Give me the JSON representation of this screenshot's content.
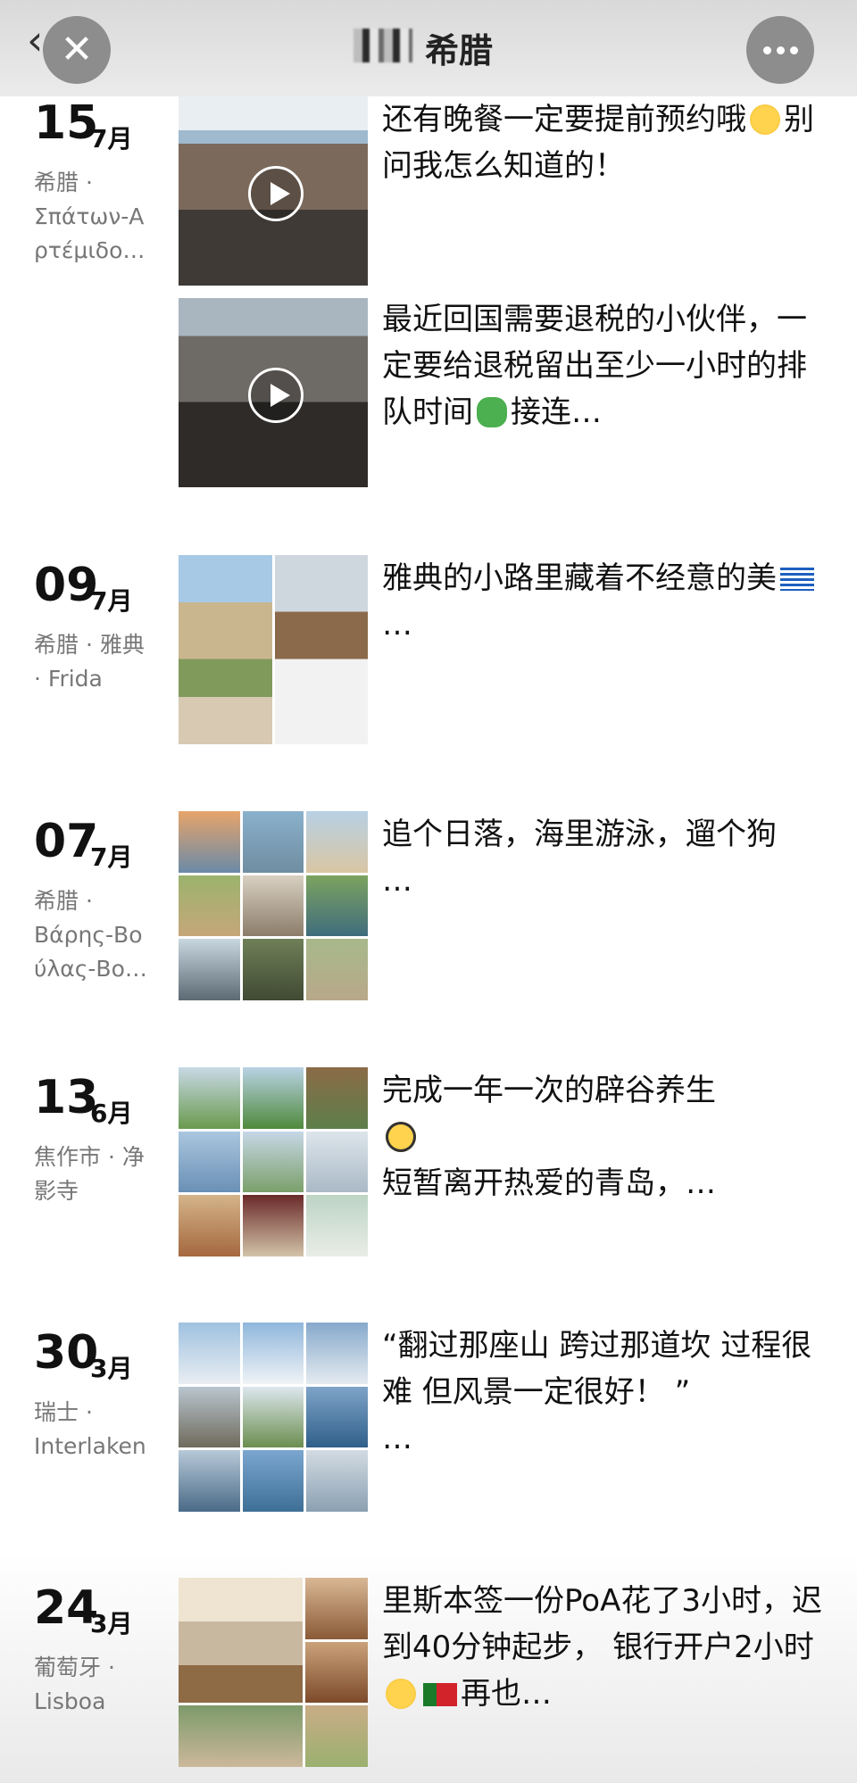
{
  "header": {
    "title": "希腊",
    "back_icon": "‹",
    "close_icon": "✕"
  },
  "entries": [
    {
      "day": "15",
      "month": "7月",
      "place": "希腊 ·\nΣπάτων-Α\nρτέμιδο…",
      "captions": [
        {
          "text_a": "还有晚餐一定要提前预约哦",
          "text_b": "别问我怎么知道的！"
        },
        {
          "text_a": "最近回国需要退税的小伙伴，一定要给退税留出至少一小时的排队时间",
          "text_b": "接连…"
        }
      ]
    },
    {
      "day": "09",
      "month": "7月",
      "place": "希腊 · 雅典\n· Frida",
      "caption": "雅典的小路里藏着不经意的美",
      "more": "…"
    },
    {
      "day": "07",
      "month": "7月",
      "place": "希腊 ·\nΒάρης-Βο\nύλας-Βο…",
      "caption": "追个日落，海里游泳，遛个狗",
      "more": "…"
    },
    {
      "day": "13",
      "month": "6月",
      "place": "焦作市 · 净\n影寺",
      "caption": "完成一年一次的辟谷养生",
      "caption2": "短暂离开热爱的青岛，…"
    },
    {
      "day": "30",
      "month": "3月",
      "place": "瑞士 ·\nInterlaken",
      "caption": "“翻过那座山 跨过那道坎 过程很难 但风景一定很好！ ”",
      "more": "…"
    },
    {
      "day": "24",
      "month": "3月",
      "place": "葡萄牙 ·\nLisboa",
      "caption_a": "里斯本签一份PoA花了3小时，迟到40分钟起步， 银行开户2小时",
      "caption_b": "再也…"
    }
  ],
  "colors": {
    "topbar": "#e2e2e2",
    "button_bg": "#8d8d8d",
    "place_text": "#777777"
  }
}
